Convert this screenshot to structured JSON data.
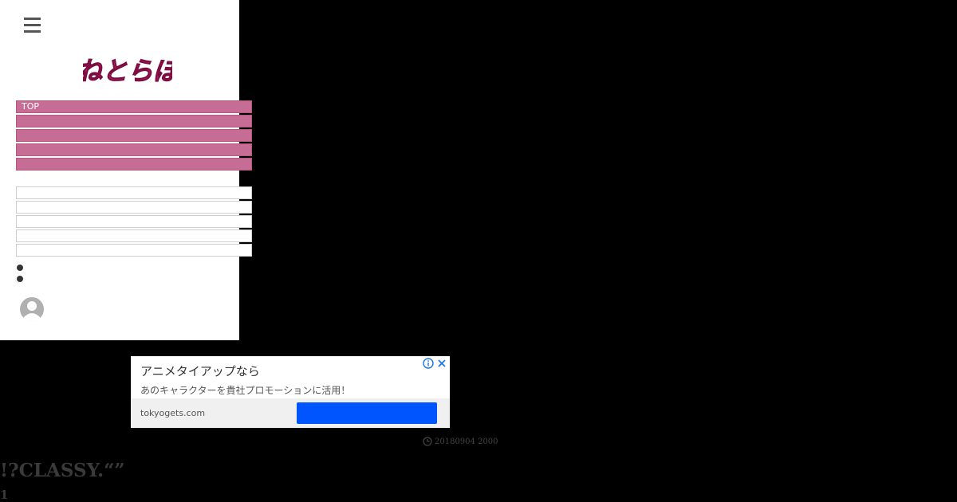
{
  "drawer": {
    "nav_items": [
      "TOP",
      "",
      "",
      "",
      ""
    ],
    "sub_items": [
      "",
      "",
      "",
      "",
      ""
    ],
    "dot_count": 2
  },
  "logo": {
    "text": "ねとらぼ",
    "color": "#c2186b"
  },
  "ad": {
    "title": "アニメタイアップなら",
    "description": "あのキャラクターを貴社プロモーションに活用！",
    "domain": "tokyogets.com",
    "cta_label": "",
    "cta_color": "#0055ff",
    "icons": [
      "info-icon",
      "close-icon"
    ]
  },
  "article": {
    "date": "20180904 2000",
    "headline": "!?CLASSY.“”",
    "page_number": "1"
  },
  "colors": {
    "nav_bg": "#c66d95",
    "background": "#000000"
  }
}
